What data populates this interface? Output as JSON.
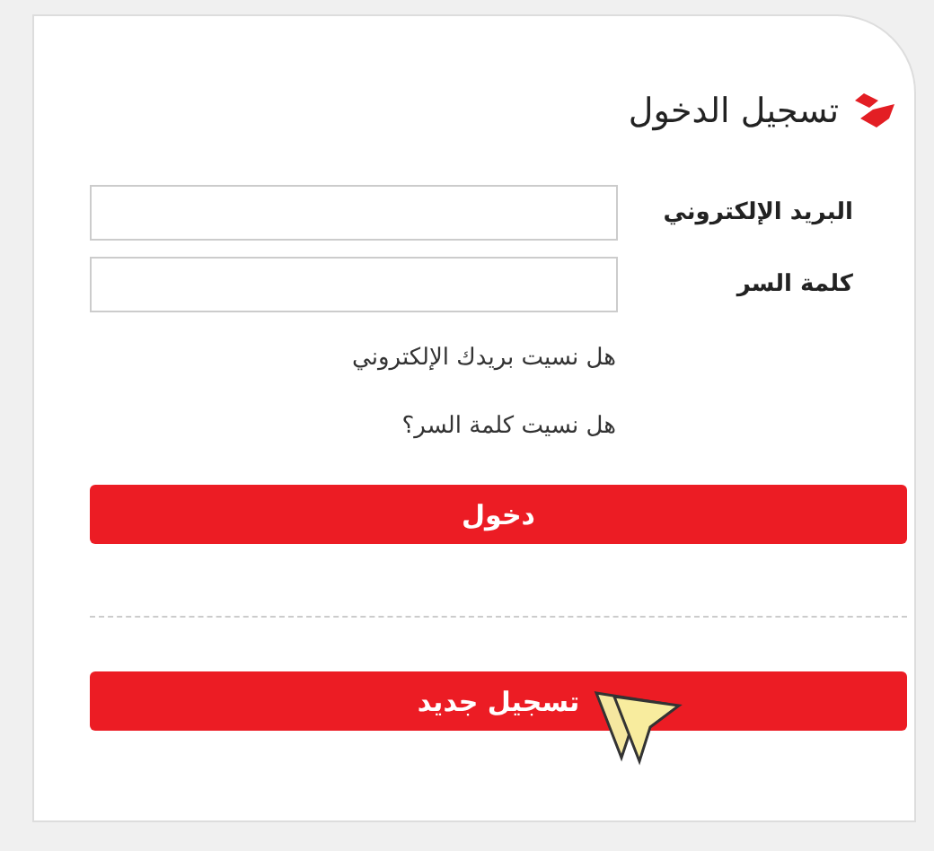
{
  "title": "تسجيل الدخول",
  "fields": [
    {
      "label": "البريد الإلكتروني"
    },
    {
      "label": "كلمة السر"
    }
  ],
  "links": [
    "هل نسيت بريدك الإلكتروني",
    "هل نسيت كلمة السر؟"
  ],
  "login_button": "دخول",
  "register_button": "تسجيل جديد"
}
